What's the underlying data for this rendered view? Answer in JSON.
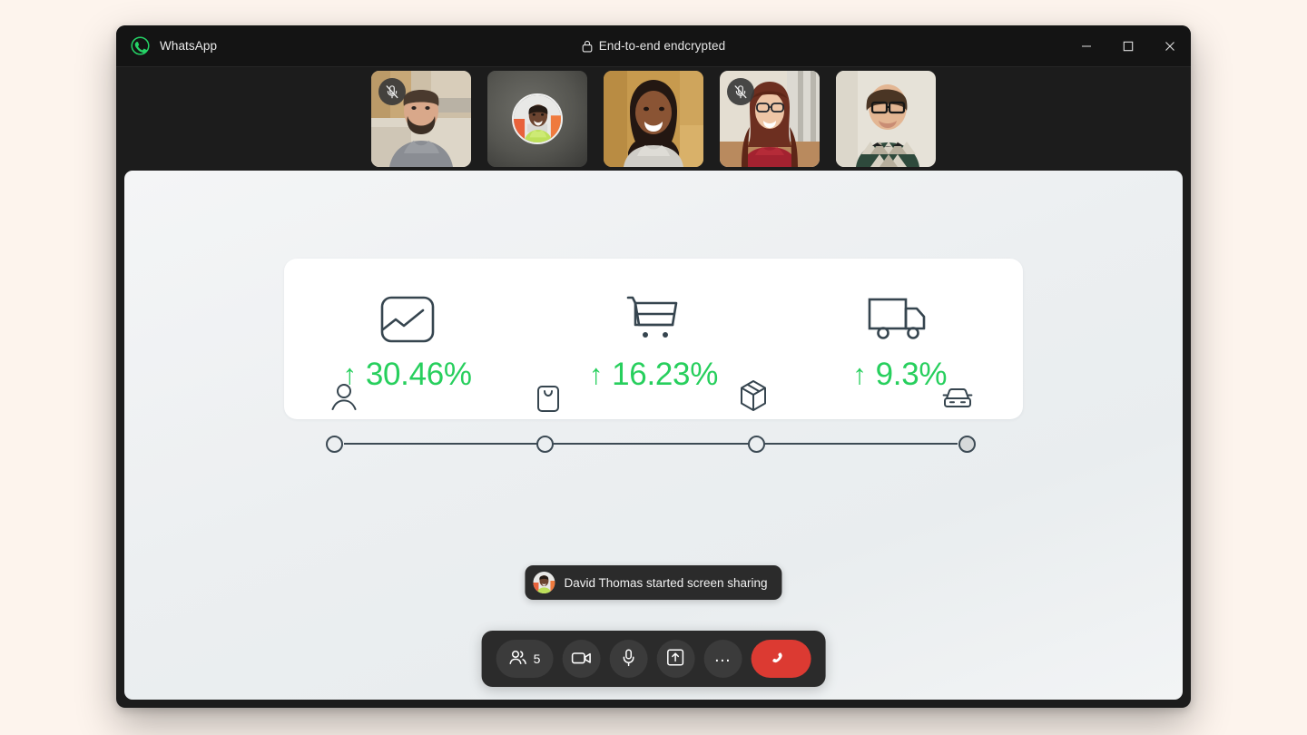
{
  "window": {
    "app_title": "WhatsApp",
    "app_logo_icon": "whatsapp-logo-icon",
    "encryption_label": "End-to-end endcrypted",
    "lock_icon": "lock-icon",
    "minimize_icon": "minimize-icon",
    "maximize_icon": "maximize-icon",
    "close_icon": "close-icon",
    "accent_color": "#25D366"
  },
  "participants": [
    {
      "id": 1,
      "name": "",
      "camera_on": true,
      "muted": true,
      "mute_icon": "mic-off-icon"
    },
    {
      "id": 2,
      "name": "",
      "camera_on": false,
      "muted": false,
      "mute_icon": "mic-off-icon"
    },
    {
      "id": 3,
      "name": "",
      "camera_on": true,
      "muted": false,
      "mute_icon": "mic-off-icon"
    },
    {
      "id": 4,
      "name": "",
      "camera_on": true,
      "muted": true,
      "mute_icon": "mic-off-icon"
    },
    {
      "id": 5,
      "name": "",
      "camera_on": true,
      "muted": false,
      "mute_icon": "mic-off-icon"
    }
  ],
  "shared_screen": {
    "stats": [
      {
        "icon": "image-chart-icon",
        "arrow": "↑",
        "value": "30.46%"
      },
      {
        "icon": "shopping-cart-icon",
        "arrow": "↑",
        "value": "16.23%"
      },
      {
        "icon": "delivery-truck-icon",
        "arrow": "↑",
        "value": "9.3%"
      }
    ],
    "stat_color": "#27cf5d",
    "timeline": [
      {
        "icon": "person-icon",
        "filled": false
      },
      {
        "icon": "shopping-bag-icon",
        "filled": false
      },
      {
        "icon": "package-box-icon",
        "filled": false
      },
      {
        "icon": "car-icon",
        "filled": true
      }
    ]
  },
  "toast": {
    "avatar_icon": "participant-avatar",
    "message": "David Thomas started screen sharing"
  },
  "controls": {
    "participants": {
      "icon": "people-icon",
      "count": "5"
    },
    "camera": {
      "icon": "video-camera-icon"
    },
    "microphone": {
      "icon": "microphone-icon"
    },
    "share_screen": {
      "icon": "share-screen-icon"
    },
    "more": {
      "icon": "more-horizontal-icon",
      "label": "…"
    },
    "end_call": {
      "icon": "end-call-icon",
      "color": "#dc3a32"
    }
  }
}
